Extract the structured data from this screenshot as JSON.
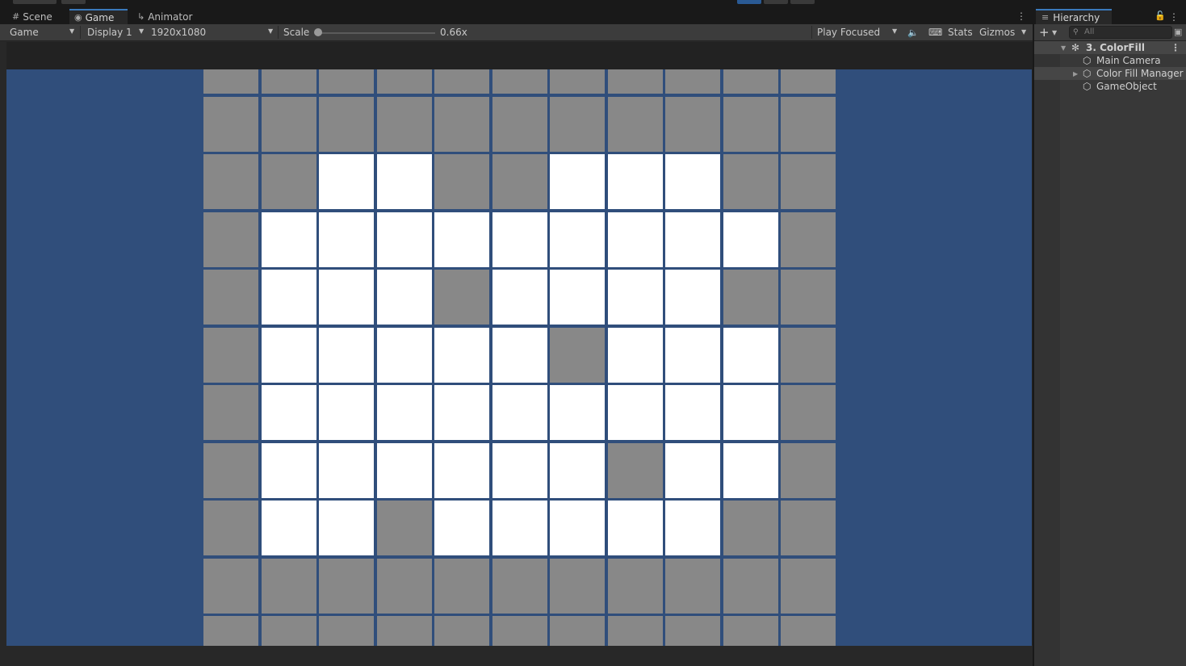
{
  "game_window": {
    "tabs": [
      {
        "label": "Scene",
        "icon": "grid-icon"
      },
      {
        "label": "Game",
        "icon": "gamepad-icon"
      },
      {
        "label": "Animator",
        "icon": "animator-icon"
      }
    ],
    "toolbar": {
      "view_mode": "Game",
      "display": "Display 1",
      "resolution": "1920x1080",
      "scale_label": "Scale",
      "scale_value": "0.66x",
      "play_mode": "Play Focused",
      "stats_label": "Stats",
      "gizmos_label": "Gizmos"
    },
    "colors": {
      "background": "#304e7b",
      "filled": "#ffffff",
      "empty": "#888888",
      "active_tab_accent": "#3a79bb"
    },
    "grid": [
      "ggggggggggg",
      "ggggggggggg",
      "ggwwggwwwgg",
      "gwwwwwwwwwg",
      "gwwwgwwwwgg",
      "gwwwwwgwwwg",
      "gwwwwwwwwwg",
      "gwwwwwwgwwg",
      "gwwgwwwwwgg",
      "ggggggggggg",
      "ggggggggggg"
    ]
  },
  "hierarchy": {
    "title": "Hierarchy",
    "search_placeholder": "All",
    "items": [
      {
        "label": "3. ColorFill",
        "icon": "unity-scene-icon"
      },
      {
        "label": "Main Camera",
        "icon": "cube-icon"
      },
      {
        "label": "Color Fill Manager",
        "icon": "cube-icon"
      },
      {
        "label": "GameObject",
        "icon": "cube-icon"
      }
    ]
  }
}
